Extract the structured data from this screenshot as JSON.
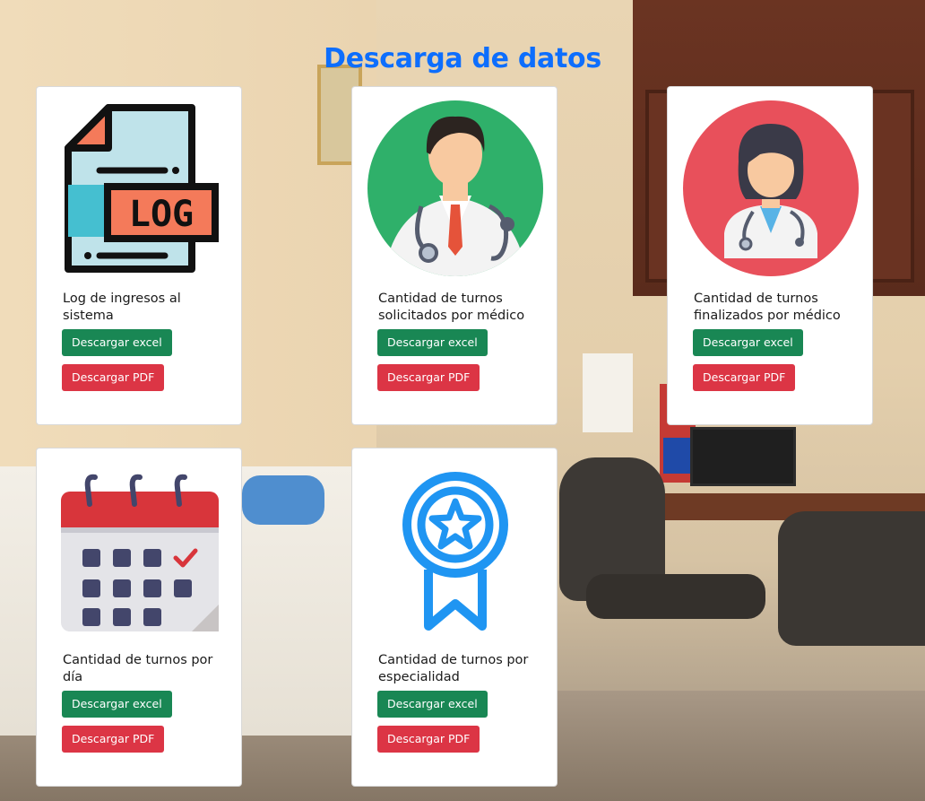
{
  "page": {
    "title": "Descarga de datos"
  },
  "cards": [
    {
      "icon": "log-file-icon",
      "icon_text": "LOG",
      "title": "Log de ingresos al sistema",
      "excel_label": "Descargar excel",
      "pdf_label": "Descargar PDF"
    },
    {
      "icon": "male-doctor-icon",
      "title": "Cantidad de turnos solicitados por médico",
      "excel_label": "Descargar excel",
      "pdf_label": "Descargar PDF"
    },
    {
      "icon": "female-doctor-icon",
      "title": "Cantidad de turnos finalizados por médico",
      "excel_label": "Descargar excel",
      "pdf_label": "Descargar PDF"
    },
    {
      "icon": "calendar-icon",
      "title": "Cantidad de turnos por día",
      "excel_label": "Descargar excel",
      "pdf_label": "Descargar PDF"
    },
    {
      "icon": "award-ribbon-icon",
      "title": "Cantidad de turnos por especialidad",
      "excel_label": "Descargar excel",
      "pdf_label": "Descargar PDF"
    }
  ],
  "colors": {
    "title": "#0d6efd",
    "excel_button": "#198754",
    "pdf_button": "#dc3545",
    "card_background": "#ffffff"
  }
}
